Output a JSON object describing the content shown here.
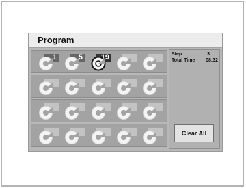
{
  "program": {
    "title": "Program",
    "tracks": [
      [
        "1",
        "5",
        "19",
        "",
        ""
      ],
      [
        "",
        "",
        "",
        "",
        ""
      ],
      [
        "",
        "",
        "",
        "",
        ""
      ],
      [
        "",
        "",
        "",
        "",
        ""
      ]
    ],
    "selected": "19"
  },
  "info": {
    "step_label": "Step",
    "step_value": "3",
    "total_time_label": "Total Time",
    "total_time_value": "08:32"
  },
  "actions": {
    "clear_all_label": "Clear All"
  },
  "colors": {
    "panel": "#b8b8b8",
    "row": "#a3a3a3",
    "title_bar": "#ececec",
    "disc": "#f4f4f4",
    "label_filled": "#666666"
  }
}
